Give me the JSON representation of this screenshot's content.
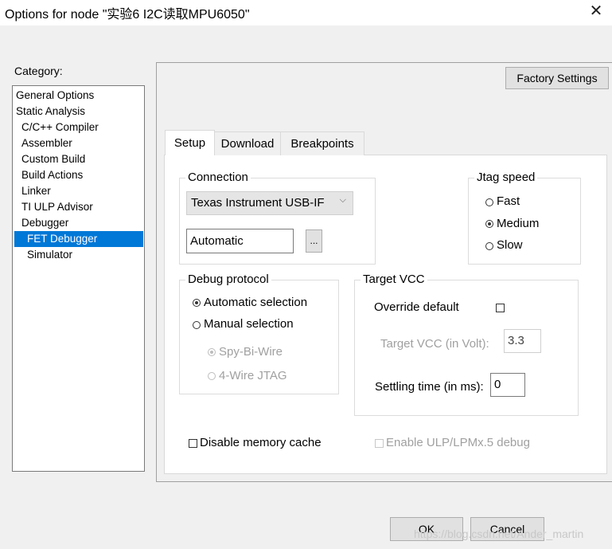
{
  "window": {
    "title": "Options for node \"实验6 I2C读取MPU6050\"",
    "close_glyph": "✕"
  },
  "category": {
    "label": "Category:",
    "items": [
      {
        "label": "General Options"
      },
      {
        "label": "Static Analysis"
      },
      {
        "label": "C/C++ Compiler"
      },
      {
        "label": "Assembler"
      },
      {
        "label": "Custom Build"
      },
      {
        "label": "Build Actions"
      },
      {
        "label": "Linker"
      },
      {
        "label": "TI ULP Advisor"
      },
      {
        "label": "Debugger"
      },
      {
        "label": "FET Debugger",
        "selected": true
      },
      {
        "label": "Simulator"
      }
    ]
  },
  "factory_settings": "Factory Settings",
  "tabs": [
    {
      "label": "Setup",
      "active": true
    },
    {
      "label": "Download"
    },
    {
      "label": "Breakpoints"
    }
  ],
  "connection": {
    "title": "Connection",
    "driver": "Texas Instrument USB-IF",
    "port_value": "Automatic",
    "browse_label": "..."
  },
  "jtag_speed": {
    "title": "Jtag speed",
    "options": [
      {
        "label": "Fast",
        "selected": false
      },
      {
        "label": "Medium",
        "selected": true
      },
      {
        "label": "Slow",
        "selected": false
      }
    ]
  },
  "debug_protocol": {
    "title": "Debug protocol",
    "automatic": "Automatic selection",
    "manual": "Manual selection",
    "spy_bi_wire": "Spy-Bi-Wire",
    "four_wire": "4-Wire JTAG"
  },
  "target_vcc": {
    "title": "Target VCC",
    "override_label": "Override default",
    "volt_label": "Target VCC (in Volt):",
    "volt_value": "3.3",
    "settling_label": "Settling time (in ms):",
    "settling_value": "0"
  },
  "options": {
    "disable_cache": "Disable memory cache",
    "enable_ulp": "Enable ULP/LPMx.5 debug"
  },
  "buttons": {
    "ok": "OK",
    "cancel": "Cancel"
  },
  "watermark": "https://blog.csdn.net/Ander_martin"
}
